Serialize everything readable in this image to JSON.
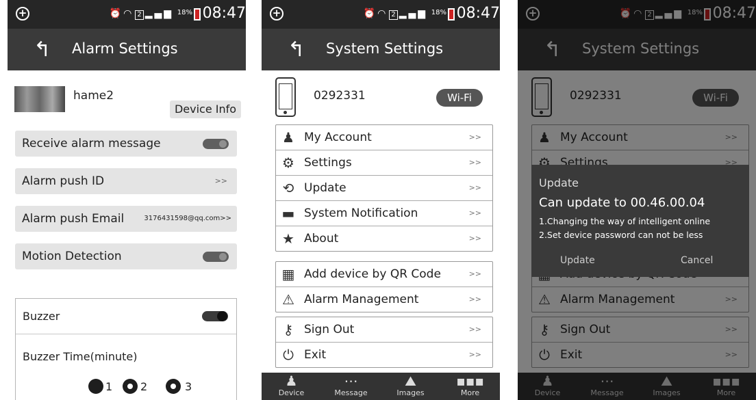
{
  "status_bar": {
    "sim": "2",
    "battery": "18%",
    "time": "08:47"
  },
  "alarm_screen": {
    "title": "Alarm Settings",
    "device_name": "hame2",
    "device_info_label": "Device Info",
    "rows": {
      "receive_alarm": "Receive alarm message",
      "push_id": "Alarm push ID",
      "push_email": "Alarm push Email",
      "push_email_value": "3176431598@qq.com",
      "motion_detection": "Motion Detection"
    },
    "buzzer": {
      "label": "Buzzer",
      "time_label": "Buzzer Time(minute)",
      "options": [
        "1",
        "2",
        "3"
      ],
      "selected": "1"
    },
    "chevron": ">>"
  },
  "system_screen": {
    "title": "System Settings",
    "device_id": "0292331",
    "wifi_label": "Wi-Fi",
    "menu_group1": [
      "My Account",
      "Settings",
      "Update",
      "System Notification",
      "About"
    ],
    "menu_group2": [
      "Add device by QR Code",
      "Alarm Management"
    ],
    "menu_group3": [
      "Sign Out",
      "Exit"
    ],
    "tabs": [
      "Device",
      "Message",
      "Images",
      "More"
    ]
  },
  "update_dialog": {
    "title": "Update",
    "version_text": "Can update to 00.46.00.04",
    "line1": "1.Changing the way of intelligent online",
    "line2": "2.Set device password can not be less",
    "update_button": "Update",
    "cancel_button": "Cancel"
  }
}
